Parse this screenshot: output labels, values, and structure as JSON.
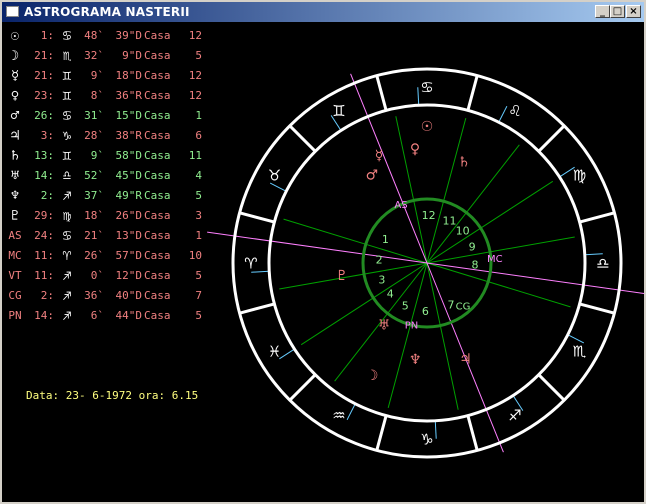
{
  "window": {
    "title": "ASTROGRAMA NASTERII",
    "buttons": {
      "min": "_",
      "max": "□",
      "close": "×"
    }
  },
  "colors": {
    "background": "#000000",
    "ring": "#ffffff",
    "inner_circle": "#228b22",
    "cusp": "#00a000",
    "axis": "#ff80ff",
    "accent": "#66ccff",
    "positive": "#90ee90",
    "negative": "#f08080",
    "date": "#ffff80"
  },
  "planets": [
    {
      "glyph": "☉",
      "icon": "sun-icon",
      "deg": "1:",
      "sign": "♋",
      "min": "48`",
      "sec": "39\"D",
      "casa": "Casa",
      "house": "12",
      "tone": "pink"
    },
    {
      "glyph": "☽",
      "icon": "moon-icon",
      "deg": "21:",
      "sign": "♏",
      "min": "32`",
      "sec": "9\"D",
      "casa": "Casa",
      "house": "5",
      "tone": "pink"
    },
    {
      "glyph": "☿",
      "icon": "mercury-icon",
      "deg": "21:",
      "sign": "♊",
      "min": "9`",
      "sec": "18\"D",
      "casa": "Casa",
      "house": "12",
      "tone": "pink"
    },
    {
      "glyph": "♀",
      "icon": "venus-icon",
      "deg": "23:",
      "sign": "♊",
      "min": "8`",
      "sec": "36\"R",
      "casa": "Casa",
      "house": "12",
      "tone": "pink"
    },
    {
      "glyph": "♂",
      "icon": "mars-icon",
      "deg": "26:",
      "sign": "♋",
      "min": "31`",
      "sec": "15\"D",
      "casa": "Casa",
      "house": "1",
      "tone": "green"
    },
    {
      "glyph": "♃",
      "icon": "jupiter-icon",
      "deg": "3:",
      "sign": "♑",
      "min": "28`",
      "sec": "38\"R",
      "casa": "Casa",
      "house": "6",
      "tone": "pink"
    },
    {
      "glyph": "♄",
      "icon": "saturn-icon",
      "deg": "13:",
      "sign": "♊",
      "min": "9`",
      "sec": "58\"D",
      "casa": "Casa",
      "house": "11",
      "tone": "green"
    },
    {
      "glyph": "♅",
      "icon": "uranus-icon",
      "deg": "14:",
      "sign": "♎",
      "min": "52`",
      "sec": "45\"D",
      "casa": "Casa",
      "house": "4",
      "tone": "green"
    },
    {
      "glyph": "♆",
      "icon": "neptune-icon",
      "deg": "2:",
      "sign": "♐",
      "min": "37`",
      "sec": "49\"R",
      "casa": "Casa",
      "house": "5",
      "tone": "green"
    },
    {
      "glyph": "♇",
      "icon": "pluto-icon",
      "deg": "29:",
      "sign": "♍",
      "min": "18`",
      "sec": "26\"D",
      "casa": "Casa",
      "house": "3",
      "tone": "pink"
    },
    {
      "glyph": "AS",
      "icon": "ascendant-label",
      "deg": "24:",
      "sign": "♋",
      "min": "21`",
      "sec": "13\"D",
      "casa": "Casa",
      "house": "1",
      "tone": "pink"
    },
    {
      "glyph": "MC",
      "icon": "midheaven-label",
      "deg": "11:",
      "sign": "♈",
      "min": "26`",
      "sec": "57\"D",
      "casa": "Casa",
      "house": "10",
      "tone": "pink"
    },
    {
      "glyph": "VT",
      "icon": "vertex-label",
      "deg": "11:",
      "sign": "♐",
      "min": "0`",
      "sec": "12\"D",
      "casa": "Casa",
      "house": "5",
      "tone": "pink"
    },
    {
      "glyph": "CG",
      "icon": "cg-label",
      "deg": "2:",
      "sign": "♐",
      "min": "36`",
      "sec": "40\"D",
      "casa": "Casa",
      "house": "7",
      "tone": "pink"
    },
    {
      "glyph": "PN",
      "icon": "pn-label",
      "deg": "14:",
      "sign": "♐",
      "min": "6`",
      "sec": "44\"D",
      "casa": "Casa",
      "house": "5",
      "tone": "pink"
    }
  ],
  "date_line": "Data: 23- 6-1972 ora: 6.15",
  "wheel": {
    "zodiac": [
      {
        "glyph": "♋",
        "name": "cancer"
      },
      {
        "glyph": "♊",
        "name": "gemini"
      },
      {
        "glyph": "♉",
        "name": "taurus"
      },
      {
        "glyph": "♈",
        "name": "aries"
      },
      {
        "glyph": "♓",
        "name": "pisces"
      },
      {
        "glyph": "♒",
        "name": "aquarius"
      },
      {
        "glyph": "♑",
        "name": "capricorn"
      },
      {
        "glyph": "♐",
        "name": "sagittarius"
      },
      {
        "glyph": "♏",
        "name": "scorpio"
      },
      {
        "glyph": "♎",
        "name": "libra"
      },
      {
        "glyph": "♍",
        "name": "virgo"
      },
      {
        "glyph": "♌",
        "name": "leo"
      }
    ],
    "houses": [
      "1",
      "2",
      "3",
      "4",
      "5",
      "6",
      "7",
      "8",
      "9",
      "10",
      "11",
      "12"
    ],
    "planet_glyphs": [
      {
        "g": "☉",
        "name": "sun-glyph",
        "c": "#f08080"
      },
      {
        "g": "☿",
        "name": "mercury-glyph",
        "c": "#f08080"
      },
      {
        "g": "♀",
        "name": "venus-glyph",
        "c": "#f08080"
      },
      {
        "g": "♂",
        "name": "mars-glyph",
        "c": "#f08080"
      },
      {
        "g": "♄",
        "name": "saturn-glyph",
        "c": "#f08080"
      },
      {
        "g": "♇",
        "name": "pluto-glyph",
        "c": "#f08080"
      },
      {
        "g": "♅",
        "name": "uranus-glyph",
        "c": "#f08080"
      },
      {
        "g": "♆",
        "name": "neptune-glyph",
        "c": "#f08080"
      },
      {
        "g": "☽",
        "name": "moon-glyph",
        "c": "#f08080"
      },
      {
        "g": "♃",
        "name": "jupiter-glyph",
        "c": "#f08080"
      }
    ],
    "axis_labels": [
      {
        "t": "AS",
        "name": "ascendant-label",
        "c": "#ff80ff"
      },
      {
        "t": "MC",
        "name": "midheaven-label",
        "c": "#ff80ff"
      },
      {
        "t": "PN",
        "name": "pn-label",
        "c": "#ff80ff"
      },
      {
        "t": "CG",
        "name": "cg-label",
        "c": "#90ee90"
      }
    ]
  }
}
